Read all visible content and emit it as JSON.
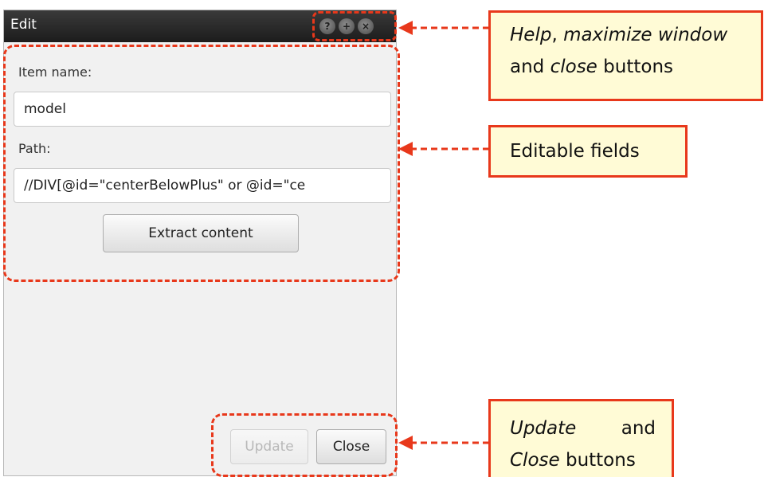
{
  "dialog": {
    "title": "Edit",
    "titlebar_buttons": [
      {
        "name": "help-icon",
        "glyph": "?"
      },
      {
        "name": "maximize-icon",
        "glyph": "+"
      },
      {
        "name": "close-icon",
        "glyph": "×"
      }
    ],
    "item_name_label": "Item name:",
    "item_name_value": "model",
    "path_label": "Path:",
    "path_value": "//DIV[@id=\"centerBelowPlus\" or @id=\"ce",
    "extract_button": "Extract content",
    "update_button": "Update",
    "close_button": "Close"
  },
  "callouts": {
    "top": {
      "line1_a": "Help",
      "line1_b": ", ",
      "line1_c": "maximize window",
      "line2_a": "and ",
      "line2_b": "close",
      "line2_c": " buttons"
    },
    "middle": {
      "text": "Editable fields"
    },
    "bottom": {
      "line1_a": "Update",
      "line1_b": "and",
      "line2_a": "Close",
      "line2_b": " buttons"
    }
  },
  "colors": {
    "accent": "#e8381b",
    "callout_fill": "#fffbd6",
    "titlebar": "#262626"
  }
}
